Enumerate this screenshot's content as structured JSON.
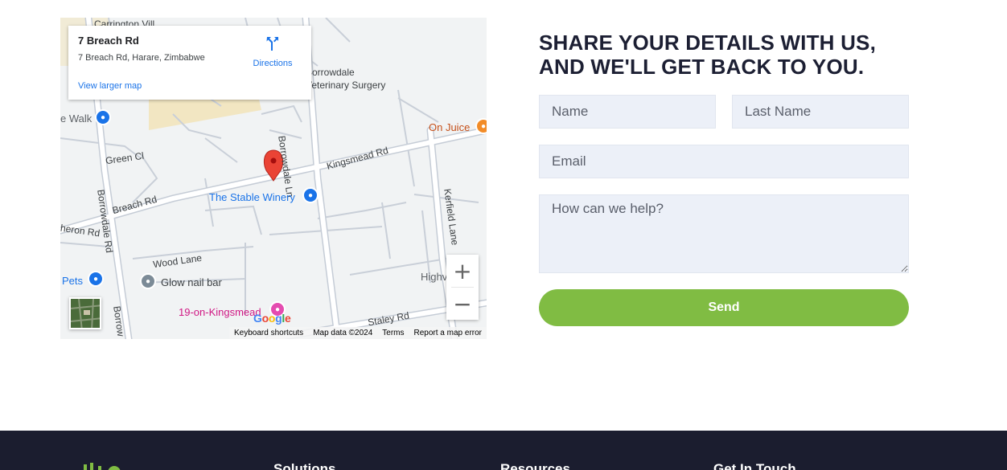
{
  "map": {
    "card": {
      "title": "7 Breach Rd",
      "address": "7 Breach Rd, Harare, Zimbabwe",
      "directions_label": "Directions",
      "larger_map_label": "View larger map"
    },
    "labels": {
      "borrowdale_vet": "Borrowdale\nVeterinary Surgery",
      "walk": "e Walk",
      "on_juice": "On Juice",
      "green_cl": "Green Cl",
      "kingsmead_rd": "Kingsmead Rd",
      "borrowdale_ln": "Borrowdale Ln",
      "breach_rd": "Breach Rd",
      "stable_winery": "The Stable Winery",
      "borrowdale_rd": "Borrowdale Rd",
      "kerfield_lane": "Kerfield Lane",
      "heron_rd": "heron Rd",
      "wood_lane": "Wood Lane",
      "highv": "Highv",
      "pets": "Pets",
      "glow_nail_bar": "Glow nail bar",
      "nineteen_on_kingsmead": "19-on-Kingsmead",
      "staley_rd": "Staley Rd",
      "borrow_bottom": "Borrow",
      "top_villa": "Carrington Vill"
    },
    "google_logo": "Google",
    "zoom_in": "+",
    "zoom_out": "−",
    "attribution": {
      "shortcuts": "Keyboard shortcuts",
      "map_data": "Map data ©2024",
      "terms": "Terms",
      "report": "Report a map error"
    },
    "colors": {
      "marker": "#ea4335",
      "poi_blue": "#1a73e8",
      "road": "#ffffff",
      "road_outline": "#c5ccd6",
      "park": "#f2e6c2"
    }
  },
  "form": {
    "title": "SHARE YOUR DETAILS WITH US, AND WE'LL GET BACK TO YOU.",
    "name_placeholder": "Name",
    "last_name_placeholder": "Last Name",
    "email_placeholder": "Email",
    "help_placeholder": "How can we help?",
    "send_label": "Send",
    "colors": {
      "title": "#1c1f33",
      "send": "#80bc43",
      "input_bg": "#ecf0f8"
    }
  },
  "footer": {
    "headings": [
      "Solutions",
      "Resources",
      "Get In Touch"
    ],
    "background": "#1b1d2f"
  }
}
